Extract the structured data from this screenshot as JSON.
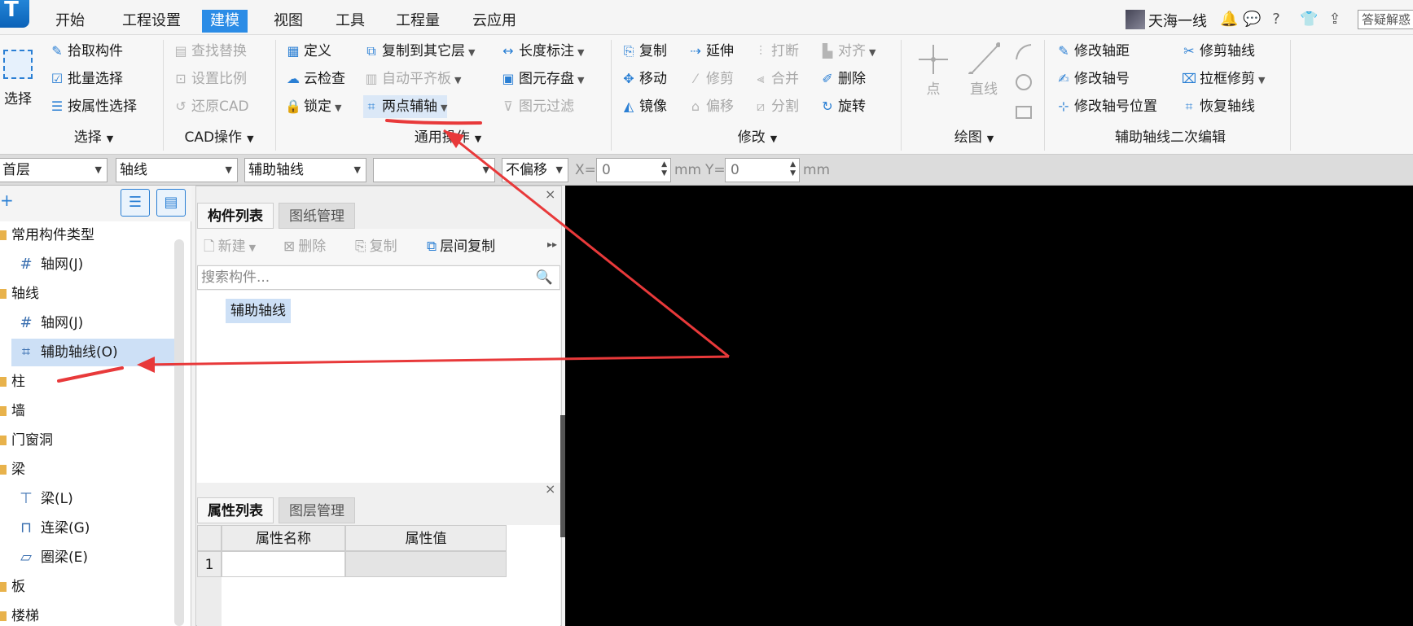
{
  "menu": {
    "logo": "T",
    "tabs": [
      "开始",
      "工程设置",
      "建模",
      "视图",
      "工具",
      "工程量",
      "云应用"
    ],
    "active_tab": "建模",
    "user_name": "天海一线",
    "help_box": "答疑解惑"
  },
  "ribbon": {
    "select_group": {
      "big_button": "选择",
      "items": [
        "拾取构件",
        "批量选择",
        "按属性选择"
      ],
      "label": "选择"
    },
    "cad_group": {
      "items": [
        "查找替换",
        "设置比例",
        "还原CAD"
      ],
      "label": "CAD操作"
    },
    "general_group": {
      "col1": [
        "定义",
        "云检查",
        "锁定"
      ],
      "col2": [
        "复制到其它层",
        "自动平齐板",
        "两点辅轴"
      ],
      "col3": [
        "长度标注",
        "图元存盘",
        "图元过滤"
      ],
      "label": "通用操作"
    },
    "modify_group": {
      "col1": [
        "复制",
        "移动",
        "镜像"
      ],
      "col2": [
        "延伸",
        "修剪",
        "偏移"
      ],
      "col3": [
        "打断",
        "合并",
        "分割"
      ],
      "col4": [
        "对齐",
        "删除",
        "旋转"
      ],
      "label": "修改"
    },
    "draw_group": {
      "point": "点",
      "line": "直线",
      "label": "绘图"
    },
    "axis_edit_group": {
      "col1": [
        "修改轴距",
        "修改轴号",
        "修改轴号位置"
      ],
      "col2": [
        "修剪轴线",
        "拉框修剪",
        "恢复轴线"
      ],
      "label": "辅助轴线二次编辑"
    }
  },
  "propbar": {
    "floor": "首层",
    "category": "轴线",
    "component": "辅助轴线",
    "blank_combo": "",
    "offset": "不偏移",
    "x_label": "X=",
    "x_value": "0",
    "y_label": "Y=",
    "y_value": "0",
    "unit": "mm"
  },
  "tree": {
    "add_icon": "+",
    "items": [
      {
        "label": "常用构件类型",
        "type": "folder"
      },
      {
        "label": "轴网(J)",
        "type": "child",
        "icon": "grid-icon"
      },
      {
        "label": "轴线",
        "type": "folder"
      },
      {
        "label": "轴网(J)",
        "type": "child",
        "icon": "grid-icon"
      },
      {
        "label": "辅助轴线(O)",
        "type": "child",
        "icon": "aux-grid-icon",
        "selected": true
      },
      {
        "label": "柱",
        "type": "folder"
      },
      {
        "label": "墙",
        "type": "folder"
      },
      {
        "label": "门窗洞",
        "type": "folder"
      },
      {
        "label": "梁",
        "type": "folder"
      },
      {
        "label": "梁(L)",
        "type": "child",
        "icon": "beam-icon"
      },
      {
        "label": "连梁(G)",
        "type": "child",
        "icon": "link-beam-icon"
      },
      {
        "label": "圈梁(E)",
        "type": "child",
        "icon": "ring-beam-icon"
      },
      {
        "label": "板",
        "type": "folder"
      },
      {
        "label": "楼梯",
        "type": "folder"
      }
    ]
  },
  "component_panel": {
    "tabs": [
      "构件列表",
      "图纸管理"
    ],
    "toolbar": [
      "新建",
      "删除",
      "复制",
      "层间复制"
    ],
    "search_placeholder": "搜索构件...",
    "selected_item": "辅助轴线"
  },
  "property_panel": {
    "tabs": [
      "属性列表",
      "图层管理"
    ],
    "col_name": "属性名称",
    "col_value": "属性值",
    "row_number": "1"
  },
  "colors": {
    "accent": "#2b8ce6",
    "annotation": "#e8393a",
    "canvas": "#000000"
  }
}
